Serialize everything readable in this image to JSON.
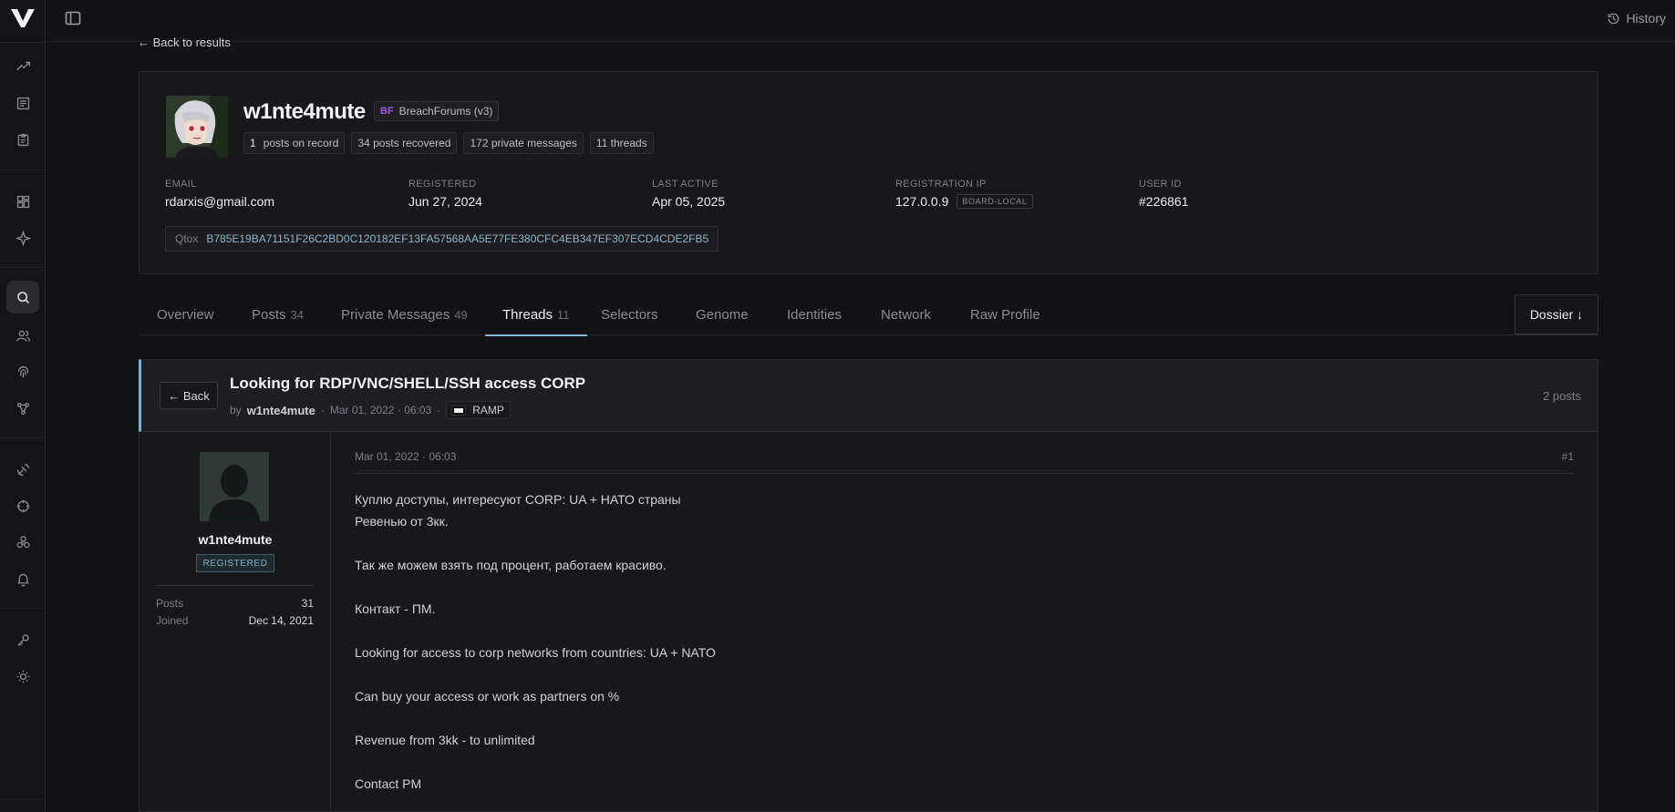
{
  "topbar": {
    "history_label": "History"
  },
  "back_to_results": "← Back to results",
  "profile": {
    "username": "w1nte4mute",
    "forum_badge": {
      "abbr": "BF",
      "label": "BreachForums (v3)"
    },
    "chips": [
      {
        "count": "1",
        "label": "posts on record"
      },
      {
        "count": "",
        "label": "34 posts recovered"
      },
      {
        "count": "",
        "label": "172 private messages"
      },
      {
        "count": "",
        "label": "11 threads"
      }
    ],
    "email_label": "EMAIL",
    "email": "rdarxis@gmail.com",
    "registered_label": "REGISTERED",
    "registered": "Jun 27, 2024",
    "last_active_label": "LAST ACTIVE",
    "last_active": "Apr 05, 2025",
    "reg_ip_label": "REGISTRATION IP",
    "reg_ip": "127.0.0.9",
    "reg_ip_tag": "BOARD-LOCAL",
    "user_id_label": "USER ID",
    "user_id": "#226861",
    "qtox_label": "Qtox",
    "qtox_value": "B785E19BA71151F26C2BD0C120182EF13FA57568AA5E77FE380CFC4EB347EF307ECD4CDE2FB5"
  },
  "tabs": [
    {
      "label": "Overview",
      "count": ""
    },
    {
      "label": "Posts",
      "count": "34"
    },
    {
      "label": "Private Messages",
      "count": "49"
    },
    {
      "label": "Threads",
      "count": "11"
    },
    {
      "label": "Selectors",
      "count": ""
    },
    {
      "label": "Genome",
      "count": ""
    },
    {
      "label": "Identities",
      "count": ""
    },
    {
      "label": "Network",
      "count": ""
    },
    {
      "label": "Raw Profile",
      "count": ""
    }
  ],
  "active_tab": "Threads",
  "dossier_label": "Dossier ↓",
  "thread": {
    "back_label": "← Back",
    "title": "Looking for RDP/VNC/SHELL/SSH access CORP",
    "by": "by",
    "author": "w1nte4mute",
    "date": "Mar 01, 2022 · 06:03",
    "source": "RAMP",
    "post_count": "2 posts"
  },
  "post": {
    "author": "w1nte4mute",
    "rank": "REGISTERED",
    "posts_label": "Posts",
    "posts_value": "31",
    "joined_label": "Joined",
    "joined_value": "Dec 14, 2021",
    "date": "Mar 01, 2022 · 06:03",
    "number": "#1",
    "lines": [
      "Куплю доступы, интересуют CORP: UA + НАТО страны",
      "Ревенью от 3кк.",
      "",
      "Так же можем взять под процент, работаем красиво.",
      "",
      "Контакт - ПМ.",
      "",
      "Looking for access to corp networks from countries: UA + NATO",
      "",
      "Can buy your access or work as partners on %",
      "",
      "Revenue from 3kk - to unlimited",
      "",
      "Contact PM"
    ]
  }
}
